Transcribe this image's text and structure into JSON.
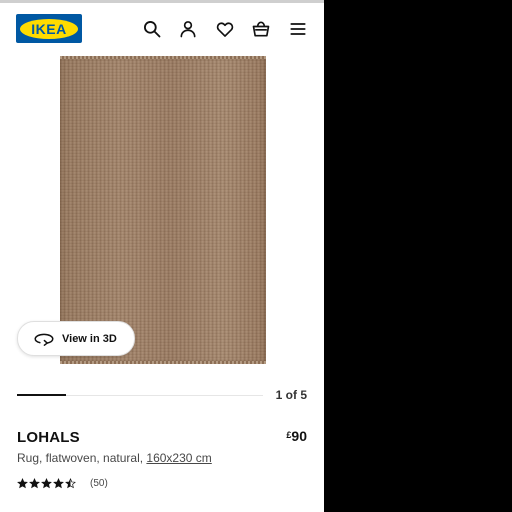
{
  "header": {
    "logo_text": "IKEA",
    "icons": [
      "search-icon",
      "user-icon",
      "heart-icon",
      "basket-icon",
      "menu-icon"
    ]
  },
  "gallery": {
    "view_3d_label": "View in 3D",
    "counter": "1 of 5",
    "current_index": 1,
    "total_images": 5
  },
  "product": {
    "name": "LOHALS",
    "price_currency": "£",
    "price_amount": "90",
    "description": "Rug, flatwoven, natural, ",
    "size": "160x230 cm",
    "rating_value": 4.5,
    "rating_max": 5,
    "reviews": "(50)"
  },
  "colors": {
    "brand_blue": "#0058a3",
    "brand_yellow": "#ffdb00",
    "rug": "#a2836a"
  }
}
